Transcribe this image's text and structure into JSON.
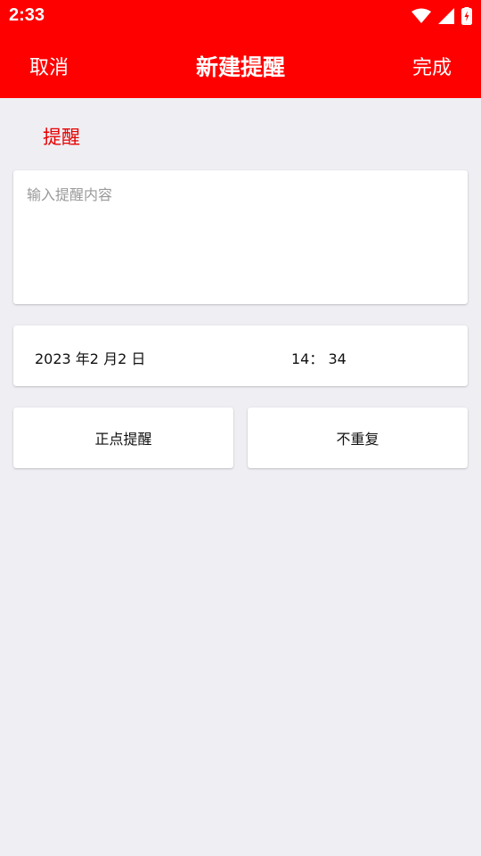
{
  "status_bar": {
    "time": "2:33",
    "icons": [
      "wifi-icon",
      "signal-icon",
      "battery-charging-icon"
    ],
    "color": "#ff0000"
  },
  "app_bar": {
    "cancel_label": "取消",
    "title": "新建提醒",
    "done_label": "完成",
    "color": "#ff0000"
  },
  "form": {
    "section_label": "提醒",
    "content_placeholder": "输入提醒内容",
    "content_value": "",
    "date": "2023 年2 月2 日",
    "time": "14： 34",
    "remind_type": "正点提醒",
    "repeat": "不重复"
  },
  "colors": {
    "accent": "#ff0000",
    "background": "#efeef3",
    "card": "#ffffff"
  }
}
